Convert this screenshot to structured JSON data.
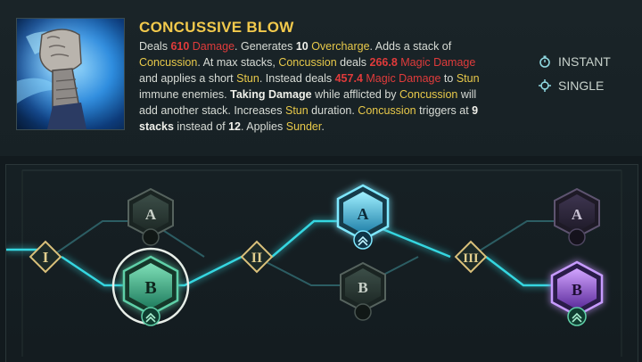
{
  "ability": {
    "name": "CONCUSSIVE BLOW",
    "desc": {
      "p1": "Deals ",
      "dmg1_val": "610",
      "dmg1_word": " Damage",
      "p2": ". Generates ",
      "overcharge_val": "10",
      "overcharge_word": " Overcharge",
      "p3": ". Adds a stack of ",
      "concussion1": "Concussion",
      "p4": ". At max stacks, ",
      "concussion2": "Concussion",
      "p5": " deals ",
      "dmg2_val": "266.8",
      "dmg2_word": " Magic Damage",
      "p6": " and applies a short ",
      "stun1": "Stun",
      "p7": ". Instead deals ",
      "dmg3_val": "457.4",
      "dmg3_word": " Magic Damage",
      "p8": " to ",
      "stun2": "Stun",
      "p9": " immune enemies. ",
      "taking": "Taking Damage",
      "p10": " while afflicted by ",
      "concussion3": "Concussion",
      "p11": " will add another stack. Increases ",
      "stun3": "Stun",
      "p12": " duration. ",
      "concussion4": "Concussion",
      "p13": " triggers at ",
      "stacks_new": "9 stacks",
      "p14": " instead of ",
      "stacks_old": "12",
      "p15": ". Applies ",
      "sunder": "Sunder",
      "p16": "."
    },
    "tags": [
      {
        "label": "INSTANT",
        "icon": "stopwatch-icon"
      },
      {
        "label": "SINGLE",
        "icon": "crosshair-icon"
      }
    ]
  },
  "tree": {
    "tiers": [
      {
        "numeral": "I"
      },
      {
        "numeral": "II"
      },
      {
        "numeral": "III"
      }
    ],
    "nodes": [
      {
        "id": "tier1-a",
        "letter": "A",
        "state": "locked"
      },
      {
        "id": "tier1-b",
        "letter": "B",
        "state": "selected"
      },
      {
        "id": "tier2-a",
        "letter": "A",
        "state": "active"
      },
      {
        "id": "tier2-b",
        "letter": "B",
        "state": "locked"
      },
      {
        "id": "tier3-a",
        "letter": "A",
        "state": "locked"
      },
      {
        "id": "tier3-b",
        "letter": "B",
        "state": "active-purple"
      }
    ],
    "colors": {
      "path": "#35d6e0",
      "green": "#3fae8a",
      "blue": "#3fb8e8",
      "purple": "#9b5de5",
      "gold": "#d9c07a"
    }
  }
}
